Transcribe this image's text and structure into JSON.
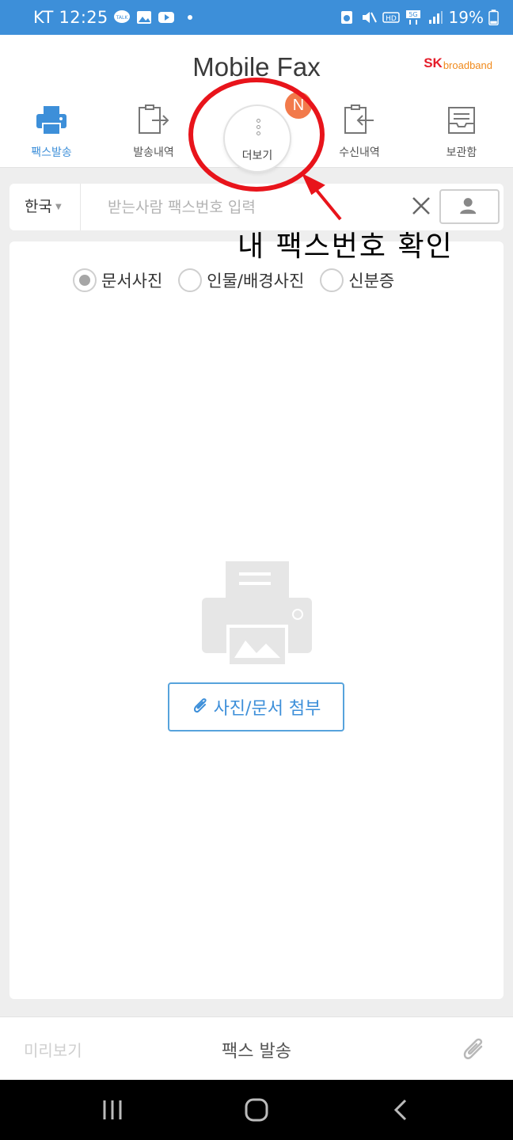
{
  "status_bar": {
    "carrier_time": "KT 12:25",
    "battery": "19%",
    "icons": [
      "kakaotalk-icon",
      "gallery-icon",
      "youtube-icon",
      "dot-icon",
      "recycle-icon",
      "mute-icon",
      "hd-icon",
      "5g-icon",
      "signal-icon",
      "battery-icon"
    ]
  },
  "header": {
    "title": "Mobile Fax",
    "brand_sk": "SK",
    "brand_suffix": "broadband"
  },
  "tabs": [
    {
      "label": "팩스발송",
      "icon": "printer-icon",
      "active": true
    },
    {
      "label": "발송내역",
      "icon": "outbox-icon",
      "active": false
    },
    {
      "label": "더보기",
      "icon": "more-dots-icon",
      "active": false
    },
    {
      "label": "수신내역",
      "icon": "inbox-icon",
      "active": false
    },
    {
      "label": "보관함",
      "icon": "archive-icon",
      "active": false
    }
  ],
  "new_badge": "N",
  "annotation": {
    "text": "내 팩스번호 확인",
    "color": "#e8141b"
  },
  "search": {
    "country": "한국",
    "placeholder": "받는사람 팩스번호 입력"
  },
  "radio_options": [
    {
      "label": "문서사진",
      "checked": true
    },
    {
      "label": "인물/배경사진",
      "checked": false
    },
    {
      "label": "신분증",
      "checked": false
    }
  ],
  "attach_button": "사진/문서 첨부",
  "bottom": {
    "preview": "미리보기",
    "send": "팩스 발송"
  },
  "colors": {
    "accent": "#3d8fd9",
    "badge": "#f27a4b",
    "brand_red": "#e51d2a",
    "brand_orange": "#f08a1c"
  }
}
